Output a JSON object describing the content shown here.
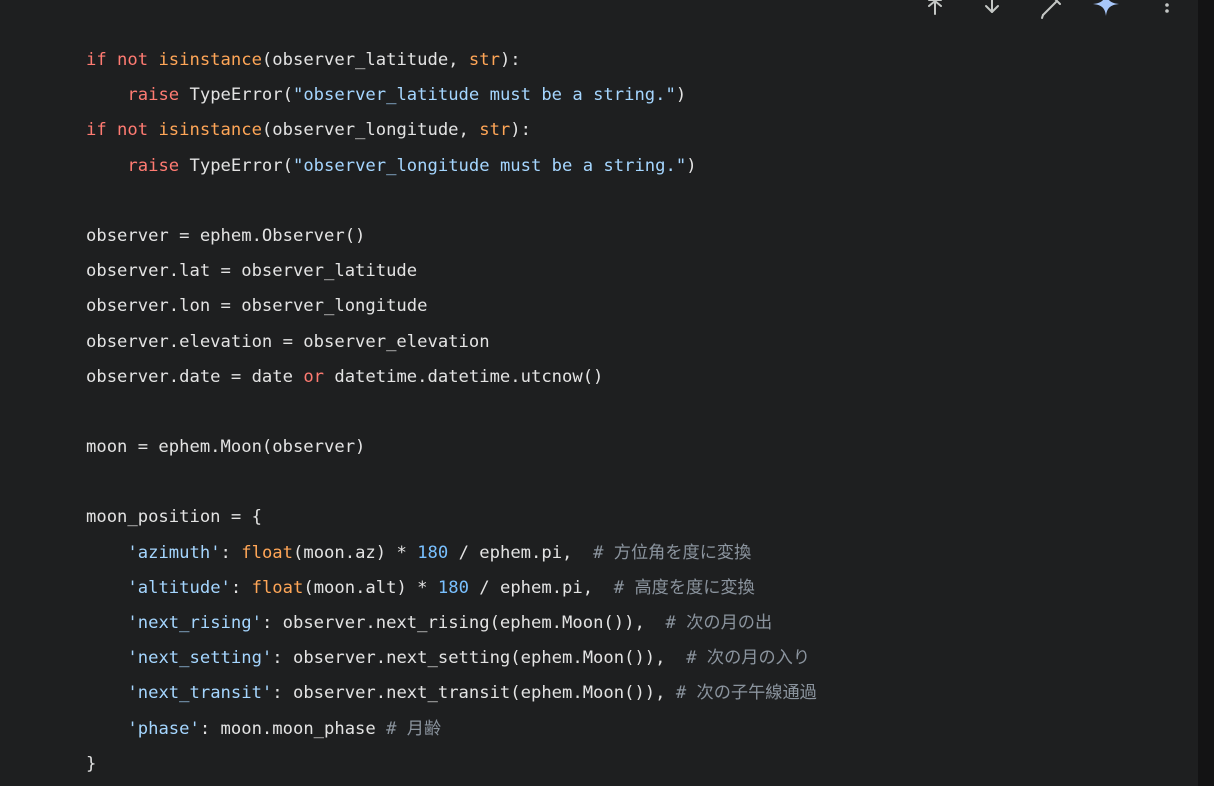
{
  "toolbar": {
    "icons": [
      "pin-icon",
      "download-icon",
      "edit-icon",
      "sparkle-icon",
      "more-vertical-icon"
    ],
    "accent": "#a8c7fa"
  },
  "colors": {
    "background": "#1e1f20",
    "text": "#e3e3e3",
    "keyword": "#ff7b72",
    "builtin": "#ffa657",
    "string": "#a5d6ff",
    "number": "#79c0ff",
    "comment": "#8b949e"
  },
  "code": {
    "lines": [
      [
        {
          "t": "if not ",
          "c": "kw"
        },
        {
          "t": "isinstance",
          "c": "bi"
        },
        {
          "t": "(observer_latitude, ",
          "c": ""
        },
        {
          "t": "str",
          "c": "bi"
        },
        {
          "t": "):",
          "c": ""
        }
      ],
      [
        {
          "t": "    ",
          "c": ""
        },
        {
          "t": "raise ",
          "c": "kw"
        },
        {
          "t": "TypeError(",
          "c": ""
        },
        {
          "t": "\"observer_latitude must be a string.\"",
          "c": "str"
        },
        {
          "t": ")",
          "c": ""
        }
      ],
      [
        {
          "t": "if not ",
          "c": "kw"
        },
        {
          "t": "isinstance",
          "c": "bi"
        },
        {
          "t": "(observer_longitude, ",
          "c": ""
        },
        {
          "t": "str",
          "c": "bi"
        },
        {
          "t": "):",
          "c": ""
        }
      ],
      [
        {
          "t": "    ",
          "c": ""
        },
        {
          "t": "raise ",
          "c": "kw"
        },
        {
          "t": "TypeError(",
          "c": ""
        },
        {
          "t": "\"observer_longitude must be a string.\"",
          "c": "str"
        },
        {
          "t": ")",
          "c": ""
        }
      ],
      [],
      [
        {
          "t": "observer = ephem.Observer()",
          "c": ""
        }
      ],
      [
        {
          "t": "observer.lat = observer_latitude",
          "c": ""
        }
      ],
      [
        {
          "t": "observer.lon = observer_longitude",
          "c": ""
        }
      ],
      [
        {
          "t": "observer.elevation = observer_elevation",
          "c": ""
        }
      ],
      [
        {
          "t": "observer.date = date ",
          "c": ""
        },
        {
          "t": "or",
          "c": "kw"
        },
        {
          "t": " datetime.datetime.utcnow()",
          "c": ""
        }
      ],
      [],
      [
        {
          "t": "moon = ephem.Moon(observer)",
          "c": ""
        }
      ],
      [],
      [
        {
          "t": "moon_position = {",
          "c": ""
        }
      ],
      [
        {
          "t": "    ",
          "c": ""
        },
        {
          "t": "'azimuth'",
          "c": "str"
        },
        {
          "t": ": ",
          "c": ""
        },
        {
          "t": "float",
          "c": "bi"
        },
        {
          "t": "(moon.az) * ",
          "c": ""
        },
        {
          "t": "180",
          "c": "num"
        },
        {
          "t": " / ephem.pi,  ",
          "c": ""
        },
        {
          "t": "# 方位角を度に変換",
          "c": "cm"
        }
      ],
      [
        {
          "t": "    ",
          "c": ""
        },
        {
          "t": "'altitude'",
          "c": "str"
        },
        {
          "t": ": ",
          "c": ""
        },
        {
          "t": "float",
          "c": "bi"
        },
        {
          "t": "(moon.alt) * ",
          "c": ""
        },
        {
          "t": "180",
          "c": "num"
        },
        {
          "t": " / ephem.pi,  ",
          "c": ""
        },
        {
          "t": "# 高度を度に変換",
          "c": "cm"
        }
      ],
      [
        {
          "t": "    ",
          "c": ""
        },
        {
          "t": "'next_rising'",
          "c": "str"
        },
        {
          "t": ": observer.next_rising(ephem.Moon()),  ",
          "c": ""
        },
        {
          "t": "# 次の月の出",
          "c": "cm"
        }
      ],
      [
        {
          "t": "    ",
          "c": ""
        },
        {
          "t": "'next_setting'",
          "c": "str"
        },
        {
          "t": ": observer.next_setting(ephem.Moon()),  ",
          "c": ""
        },
        {
          "t": "# 次の月の入り",
          "c": "cm"
        }
      ],
      [
        {
          "t": "    ",
          "c": ""
        },
        {
          "t": "'next_transit'",
          "c": "str"
        },
        {
          "t": ": observer.next_transit(ephem.Moon()), ",
          "c": ""
        },
        {
          "t": "# 次の子午線通過",
          "c": "cm"
        }
      ],
      [
        {
          "t": "    ",
          "c": ""
        },
        {
          "t": "'phase'",
          "c": "str"
        },
        {
          "t": ": moon.moon_phase ",
          "c": ""
        },
        {
          "t": "# 月齢",
          "c": "cm"
        }
      ],
      [
        {
          "t": "}",
          "c": ""
        }
      ]
    ]
  }
}
